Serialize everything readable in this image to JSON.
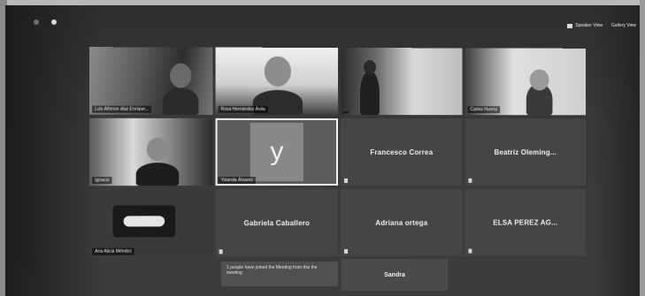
{
  "window": {
    "controls": [
      {
        "label": "Speaker View",
        "icon": "speaker-view-icon"
      },
      {
        "label": "Gallery View",
        "icon": "gallery-view-icon"
      }
    ]
  },
  "tiles": [
    {
      "kind": "video",
      "caption": "Luis Alfonso diaz Enrique..."
    },
    {
      "kind": "video",
      "caption": "Rosa Hernández Ávila"
    },
    {
      "kind": "video",
      "caption": ""
    },
    {
      "kind": "video",
      "caption": "Carlos Huerta"
    },
    {
      "kind": "video",
      "caption": "Ignacio"
    },
    {
      "kind": "avatar",
      "letter": "y",
      "caption": "Yolanda Álvarez"
    },
    {
      "kind": "name",
      "name": "Francesco Correa"
    },
    {
      "kind": "name",
      "name": "Beatriz Oleming..."
    },
    {
      "kind": "video",
      "caption": "Ana Alicia Méndez"
    },
    {
      "kind": "name",
      "name": "Gabriela Caballero"
    },
    {
      "kind": "name",
      "name": "Adriana ortega"
    },
    {
      "kind": "name",
      "name": "ELSA PEREZ AG..."
    }
  ],
  "notice": "1 people have joined the Meeting from this the meeting",
  "bottom_tile": {
    "name": "Sandra"
  }
}
